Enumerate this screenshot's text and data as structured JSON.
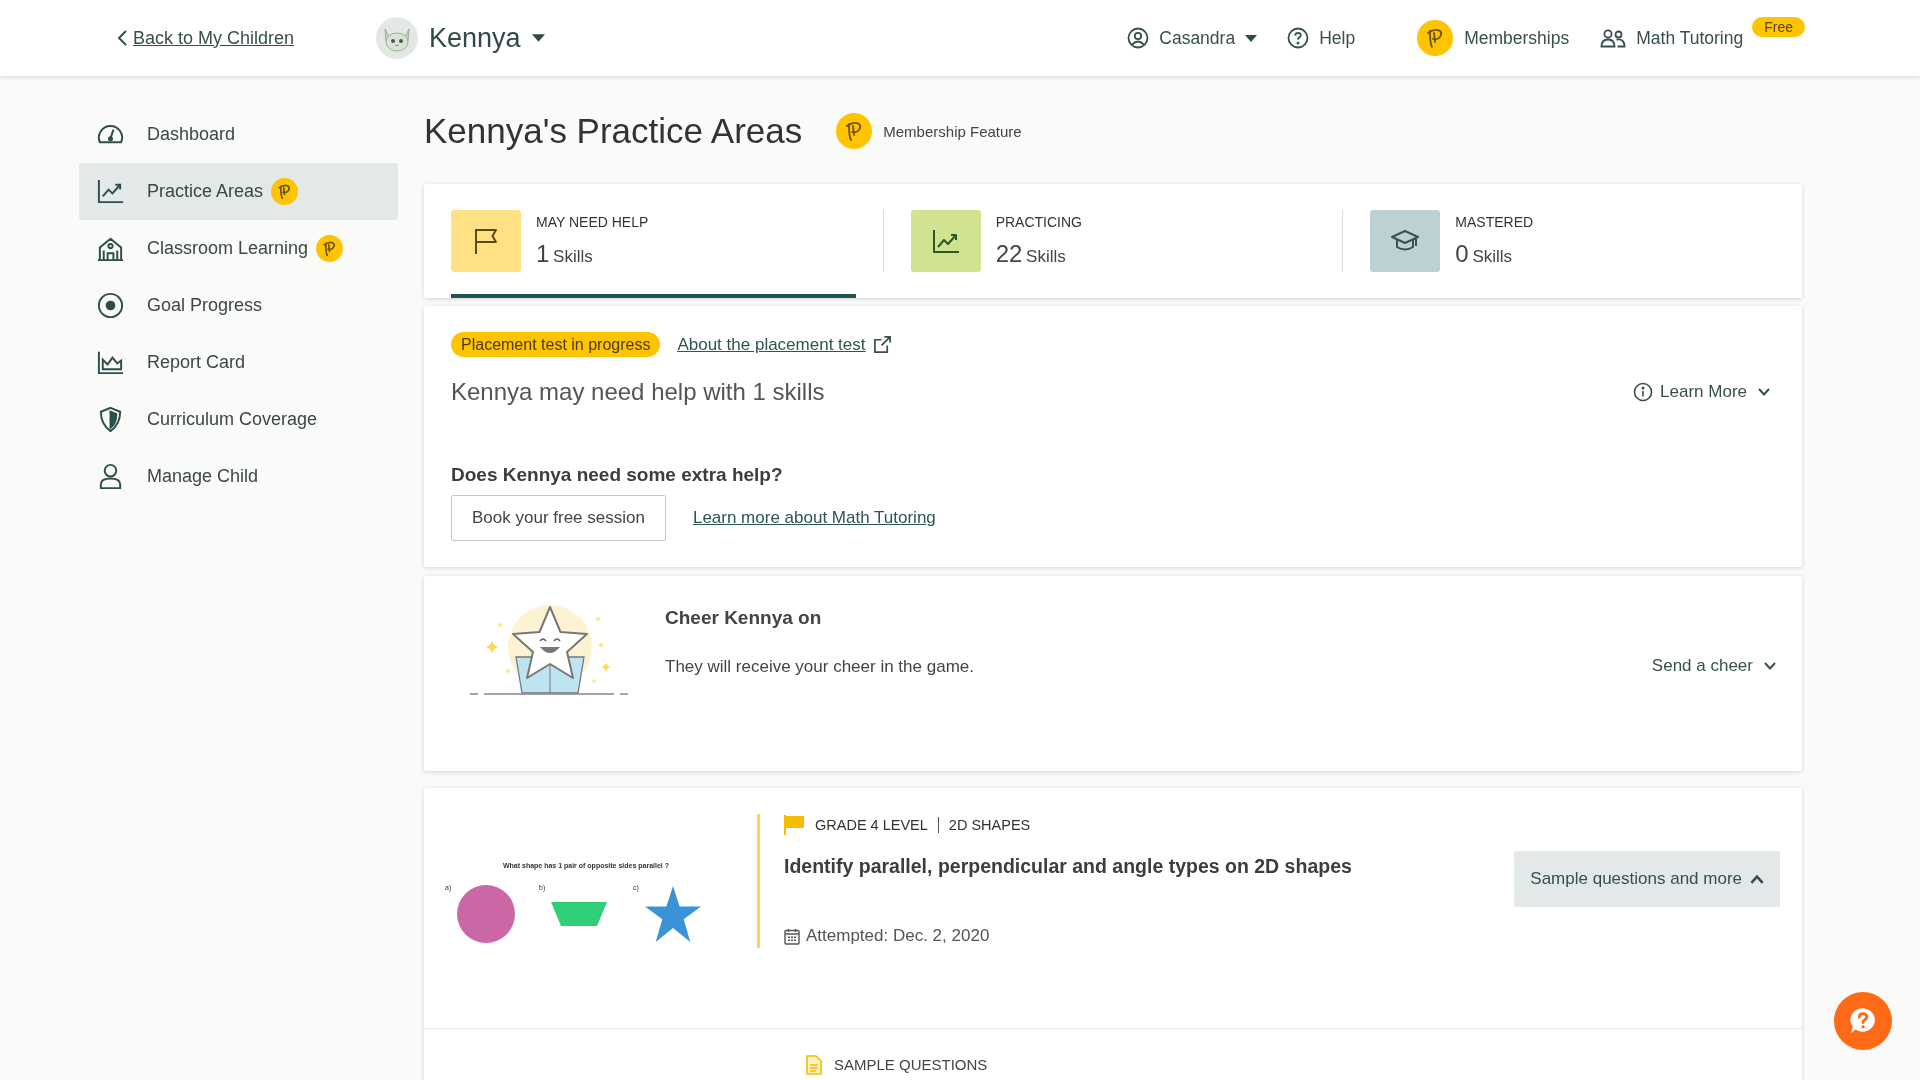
{
  "top_bar": {
    "back_link": "Back to My Children",
    "child_name": "Kennya",
    "user_name": "Casandra",
    "help": "Help",
    "memberships": "Memberships",
    "math_tutoring": "Math Tutoring",
    "math_tutoring_badge": "Free"
  },
  "sidebar": {
    "items": [
      {
        "label": "Dashboard",
        "selected": false,
        "membership": false
      },
      {
        "label": "Practice Areas",
        "selected": true,
        "membership": true
      },
      {
        "label": "Classroom Learning",
        "selected": false,
        "membership": true
      },
      {
        "label": "Goal Progress",
        "selected": false,
        "membership": false
      },
      {
        "label": "Report Card",
        "selected": false,
        "membership": false
      },
      {
        "label": "Curriculum Coverage",
        "selected": false,
        "membership": false
      },
      {
        "label": "Manage Child",
        "selected": false,
        "membership": false
      }
    ]
  },
  "page": {
    "title": "Kennya's Practice Areas",
    "membership_feature": "Membership Feature"
  },
  "stats": [
    {
      "label": "MAY NEED HELP",
      "count": "1",
      "unit": "Skills",
      "selected": true
    },
    {
      "label": "PRACTICING",
      "count": "22",
      "unit": "Skills",
      "selected": false
    },
    {
      "label": "MASTERED",
      "count": "0",
      "unit": "Skills",
      "selected": false
    }
  ],
  "placement": {
    "status": "Placement test in progress",
    "about_link": "About the placement test",
    "summary": "Kennya may need help with 1 skills",
    "learn_more": "Learn More",
    "question": "Does Kennya need some extra help?",
    "book_button": "Book your free session",
    "tutoring_link": "Learn more about Math Tutoring"
  },
  "cheer": {
    "title": "Cheer Kennya on",
    "text": "They will receive your cheer in the game.",
    "action": "Send a cheer"
  },
  "skill": {
    "preview": {
      "question": "What shape has 1 pair of opposite sides parallel ?",
      "options": [
        {
          "label": "a)",
          "kind": "circle"
        },
        {
          "label": "b)",
          "kind": "trapezoid"
        },
        {
          "label": "c)",
          "kind": "star"
        }
      ]
    },
    "grade": "GRADE 4 LEVEL",
    "topic": "2D SHAPES",
    "title": "Identify parallel, perpendicular and angle types on 2D shapes",
    "attempted": "Attempted: Dec. 2, 2020",
    "button": "Sample questions and more",
    "expanded": true,
    "section": "SAMPLE QUESTIONS"
  }
}
